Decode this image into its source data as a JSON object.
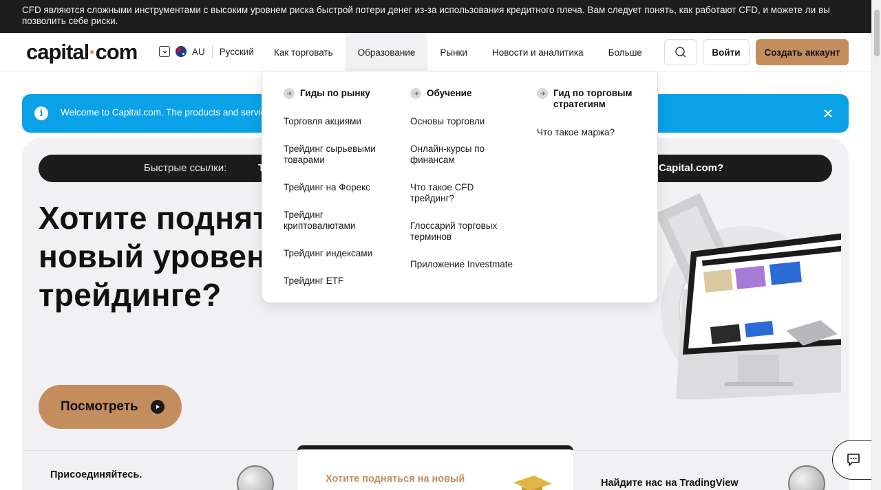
{
  "risk_banner": {
    "text": "CFD являются сложными инструментами с высоким уровнем риска быстрой потери денег из-за использования кредитного плеча. Вам следует понять, как работают CFD, и можете ли вы позволить себе риски."
  },
  "header": {
    "logo_main": "capital",
    "logo_dot": "·",
    "logo_suffix": "com",
    "region": "AU",
    "language": "Русский",
    "nav": [
      {
        "label": "Как торговать"
      },
      {
        "label": "Образование"
      },
      {
        "label": "Рынки"
      },
      {
        "label": "Новости и аналитика"
      },
      {
        "label": "Больше"
      }
    ],
    "login_label": "Войти",
    "signup_label": "Создать аккаунт"
  },
  "info_bar": {
    "text": "Welcome to Capital.com. The products and servic"
  },
  "hero": {
    "quicklinks_label": "Быстрые ссылки:",
    "quicklink_start": "Т",
    "quicklink_end": "Capital.com?",
    "title": "Хотите поднят новый уровен трейдинге?",
    "title_lines": [
      "Хотите поднят",
      "новый уровен",
      "трейдинге?"
    ],
    "watch_label": "Посмотреть"
  },
  "mega_menu": {
    "columns": [
      {
        "heading": "Гиды по рынку",
        "items": [
          "Торговля акциями",
          "Трейдинг сырьевыми товарами",
          "Трейдинг на Форекс",
          "Трейдинг криптовалютами",
          "Трейдинг индексами",
          "Трейдинг ETF"
        ]
      },
      {
        "heading": "Обучение",
        "items": [
          "Основы торговли",
          "Онлайн-курсы по финансам",
          "Что такое CFD трейдинг?",
          "Глоссарий торговых терминов",
          "Приложение Investmate"
        ]
      },
      {
        "heading": "Гид по торговым стратегиям",
        "items": [
          "Что такое маржа?"
        ]
      }
    ]
  },
  "bottom_cards": {
    "left_title": "Присоединяйтесь.",
    "mid_title": "Хотите подняться на новый",
    "right_title": "Найдите нас на TradingView"
  },
  "colors": {
    "accent": "#c48d5e",
    "banner_bg": "#1d1d1d",
    "info_blue": "#0aa1e6",
    "hero_bg": "#f1f1f3"
  },
  "icons": [
    "chevron-down-icon",
    "flag-au-icon",
    "search-icon",
    "info-icon",
    "close-icon",
    "play-icon",
    "arrow-right-icon",
    "chat-icon",
    "graduation-cap-icon"
  ]
}
